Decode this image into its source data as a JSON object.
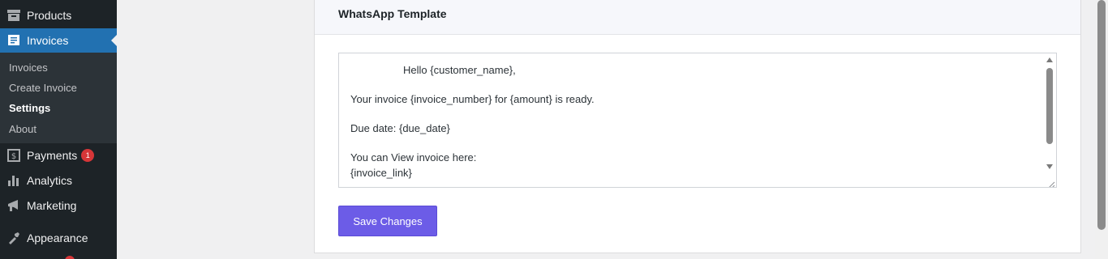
{
  "sidebar": {
    "items": [
      {
        "label": "Products",
        "icon": "products-icon"
      },
      {
        "label": "Invoices",
        "icon": "invoices-icon"
      },
      {
        "label": "Payments",
        "icon": "payments-icon",
        "badge": "1"
      },
      {
        "label": "Analytics",
        "icon": "analytics-icon"
      },
      {
        "label": "Marketing",
        "icon": "marketing-icon"
      },
      {
        "label": "Appearance",
        "icon": "appearance-icon"
      }
    ],
    "submenu": [
      {
        "label": "Invoices"
      },
      {
        "label": "Create Invoice"
      },
      {
        "label": "Settings",
        "current": true
      },
      {
        "label": "About"
      }
    ]
  },
  "panel": {
    "title": "WhatsApp Template",
    "template_lines": [
      "                  Hello {customer_name},",
      "Your invoice {invoice_number} for {amount} is ready.",
      "Due date: {due_date}",
      "You can View invoice here:",
      "{invoice_link}"
    ],
    "save_label": "Save Changes"
  },
  "colors": {
    "sidebar_bg": "#1d2327",
    "submenu_bg": "#2c3338",
    "active_blue": "#2271b1",
    "badge_red": "#d63638",
    "button_purple": "#6c5ce7"
  }
}
